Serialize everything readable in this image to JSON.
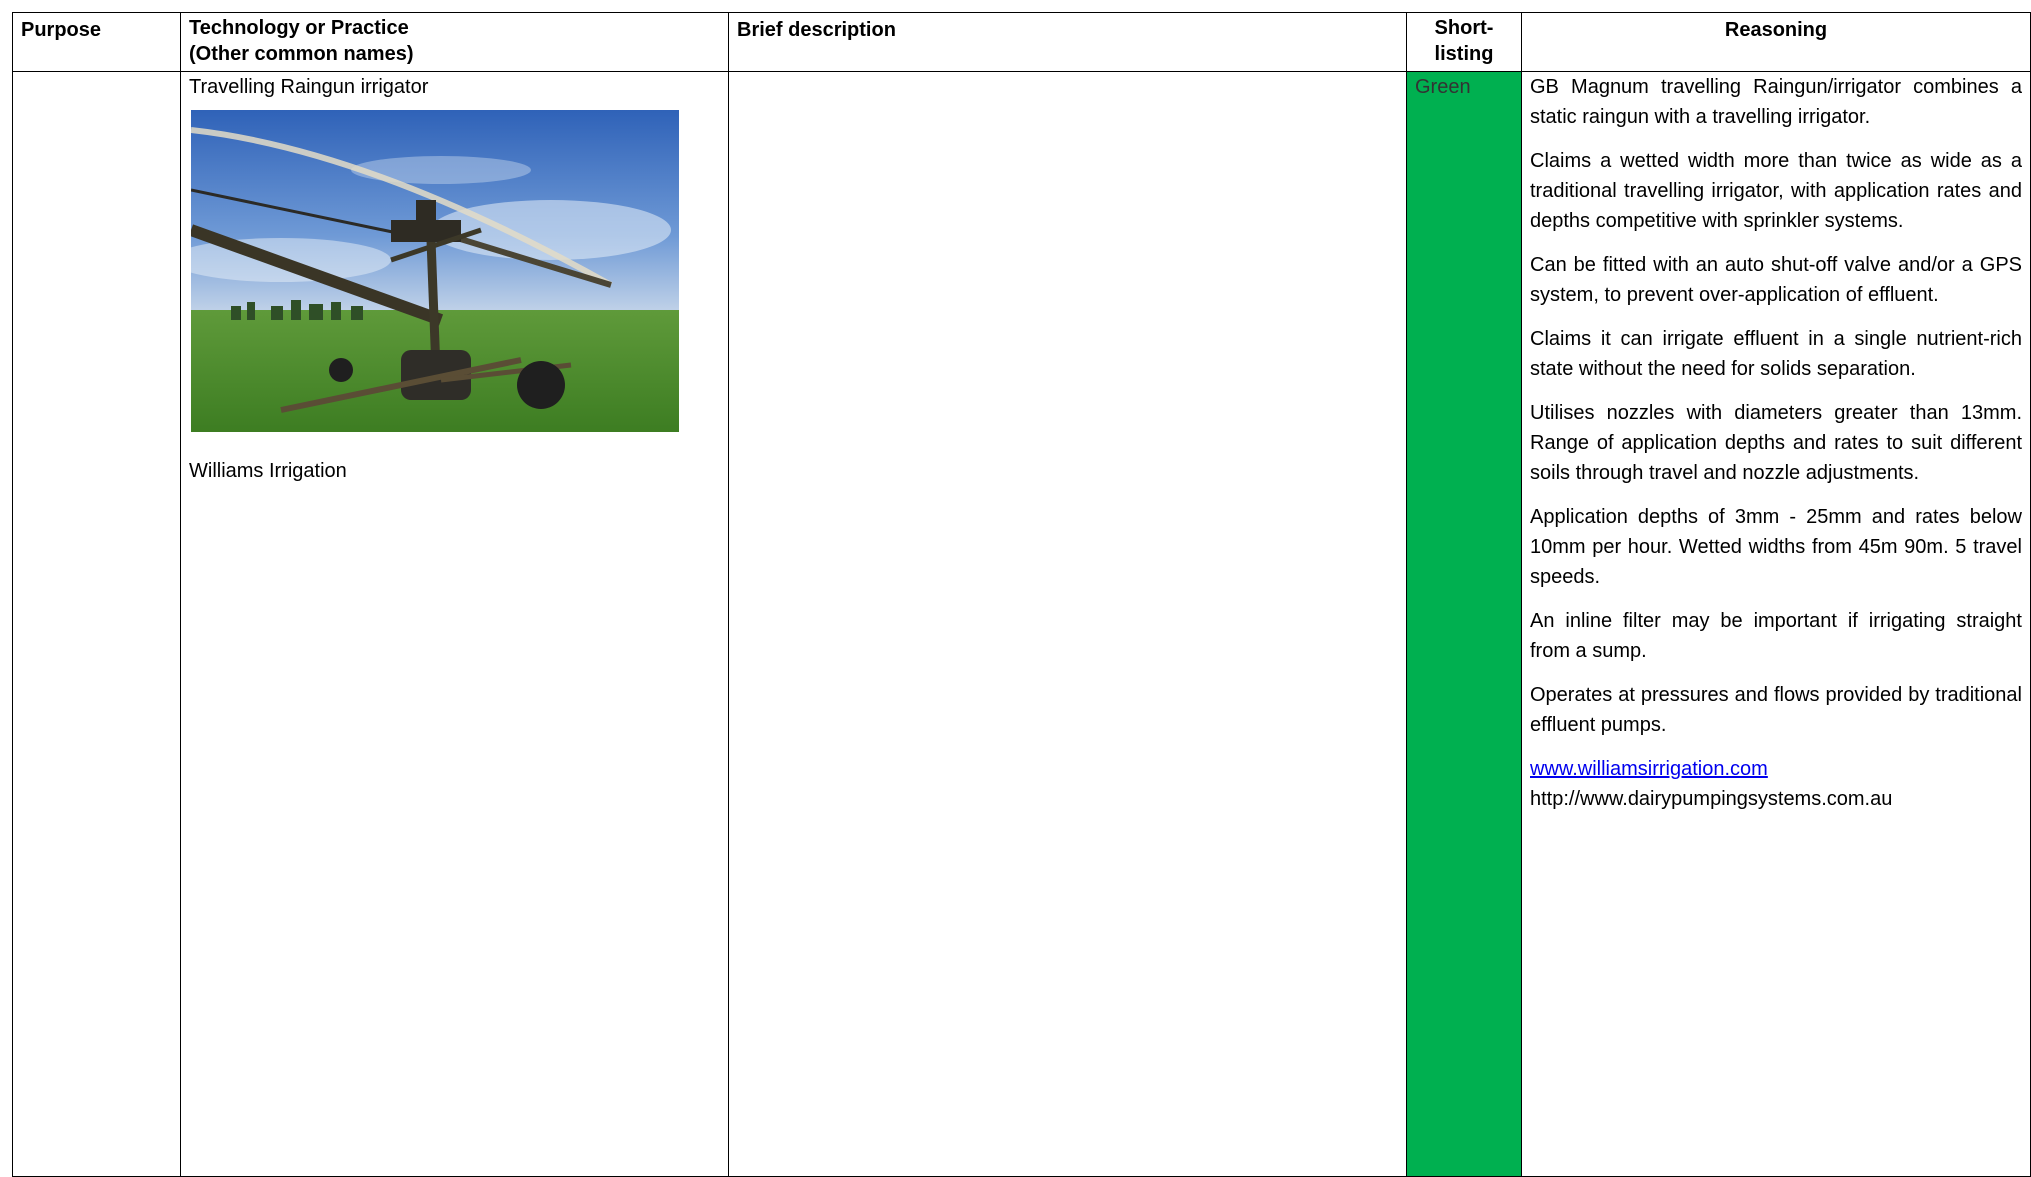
{
  "header": {
    "purpose": "Purpose",
    "technology_line1": "Technology or Practice",
    "technology_line2": "(Other common names)",
    "brief": "Brief description",
    "short_line1": "Short-",
    "short_line2": "listing",
    "reasoning": "Reasoning"
  },
  "row": {
    "purpose": "",
    "technology_name": "Travelling Raingun irrigator",
    "image_subject": "travelling raingun irrigator in green pasture",
    "supplier": "Williams Irrigation",
    "brief": "",
    "shortlisting": "Green",
    "shortlisting_color": "#00b050",
    "reasoning": [
      "GB Magnum travelling Raingun/irrigator combines a static raingun with a travelling irrigator.",
      "Claims a wetted width more than twice as wide as a traditional travelling irrigator,  with application rates and depths competitive with sprinkler systems.",
      "Can be fitted with an auto shut-off valve and/or a GPS system, to prevent over-application of effluent.",
      "Claims it can irrigate effluent in a single nutrient-rich state without the need for solids separation.",
      "Utilises nozzles with diameters greater than 13mm.  Range of application depths and rates to suit different soils through travel and nozzle adjustments.",
      "Application depths of 3mm - 25mm and rates below 10mm per hour. Wetted widths from 45m 90m. 5 travel speeds.",
      "An inline filter may be important if irrigating straight from a sump.",
      "Operates at pressures and flows provided by traditional effluent pumps."
    ],
    "link_1": "www.williamsirrigation.com",
    "link_2": "http://www.dairypumpingsystems.com.au"
  }
}
